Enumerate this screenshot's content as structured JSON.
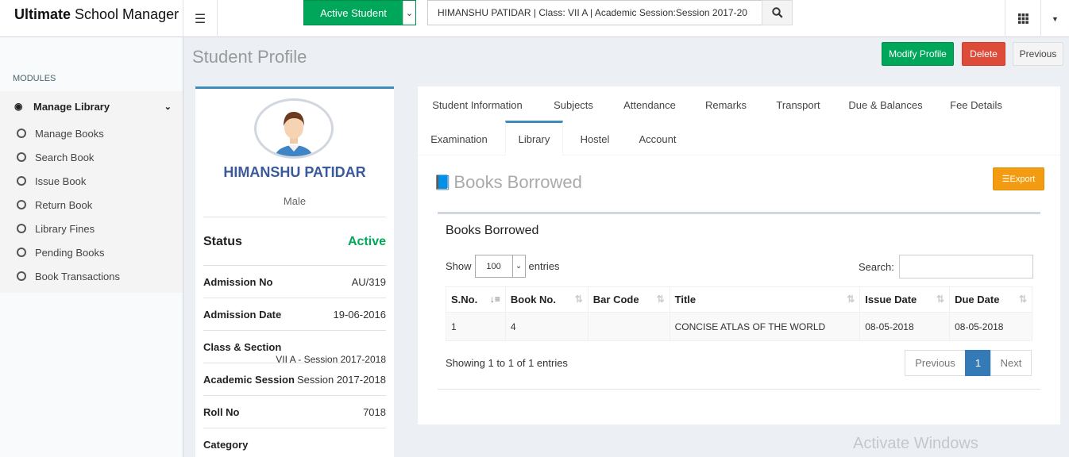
{
  "app": {
    "brand_bold": "Ultimate",
    "brand_rest": " School Manager"
  },
  "topbar": {
    "active_student_label": "Active Student",
    "student_search_value": "HIMANSHU PATIDAR | Class: VII A | Academic Session:Session 2017-20"
  },
  "sidebar": {
    "header": "MODULES",
    "menu_title": "Manage Library",
    "items": [
      {
        "label": "Manage Books"
      },
      {
        "label": "Search Book"
      },
      {
        "label": "Issue Book"
      },
      {
        "label": "Return Book"
      },
      {
        "label": "Library Fines"
      },
      {
        "label": "Pending Books"
      },
      {
        "label": "Book Transactions"
      }
    ]
  },
  "page": {
    "title": "Student Profile",
    "buttons": {
      "modify": "Modify Profile",
      "delete": "Delete",
      "previous": "Previous"
    }
  },
  "profile": {
    "name": "HIMANSHU PATIDAR",
    "gender": "Male",
    "status_label": "Status",
    "status_value": "Active",
    "status_color": "#00a65a",
    "fields": [
      {
        "label": "Admission No",
        "value": "AU/319"
      },
      {
        "label": "Admission Date",
        "value": "19-06-2016"
      },
      {
        "label": "Class & Section",
        "value": "VII A - Session 2017-2018"
      },
      {
        "label": "Academic Session",
        "value": "Session 2017-2018"
      },
      {
        "label": "Roll No",
        "value": "7018"
      },
      {
        "label": "Category",
        "value": ""
      }
    ]
  },
  "tabs": [
    {
      "label": "Student Information"
    },
    {
      "label": "Subjects"
    },
    {
      "label": "Attendance"
    },
    {
      "label": "Remarks"
    },
    {
      "label": "Transport"
    },
    {
      "label": "Due & Balances"
    },
    {
      "label": "Fee Details"
    },
    {
      "label": "Examination"
    },
    {
      "label": "Library",
      "active": true
    },
    {
      "label": "Hostel"
    },
    {
      "label": "Account"
    }
  ],
  "library": {
    "section_title": "Books Borrowed",
    "export_label": "Export",
    "box_title": "Books Borrowed",
    "show_label": "Show",
    "entries_label": "entries",
    "page_size": "100",
    "search_label": "Search:",
    "search_value": "",
    "columns": [
      "S.No.",
      "Book No.",
      "Bar Code",
      "Title",
      "Issue Date",
      "Due Date"
    ],
    "rows": [
      {
        "sno": "1",
        "book_no": "4",
        "bar_code": "",
        "title": "CONCISE ATLAS OF THE WORLD",
        "issue_date": "08-05-2018",
        "due_date": "08-05-2018"
      }
    ],
    "info": "Showing 1 to 1 of 1 entries",
    "pager": {
      "previous": "Previous",
      "page": "1",
      "next": "Next"
    }
  },
  "watermark": "Activate Windows"
}
